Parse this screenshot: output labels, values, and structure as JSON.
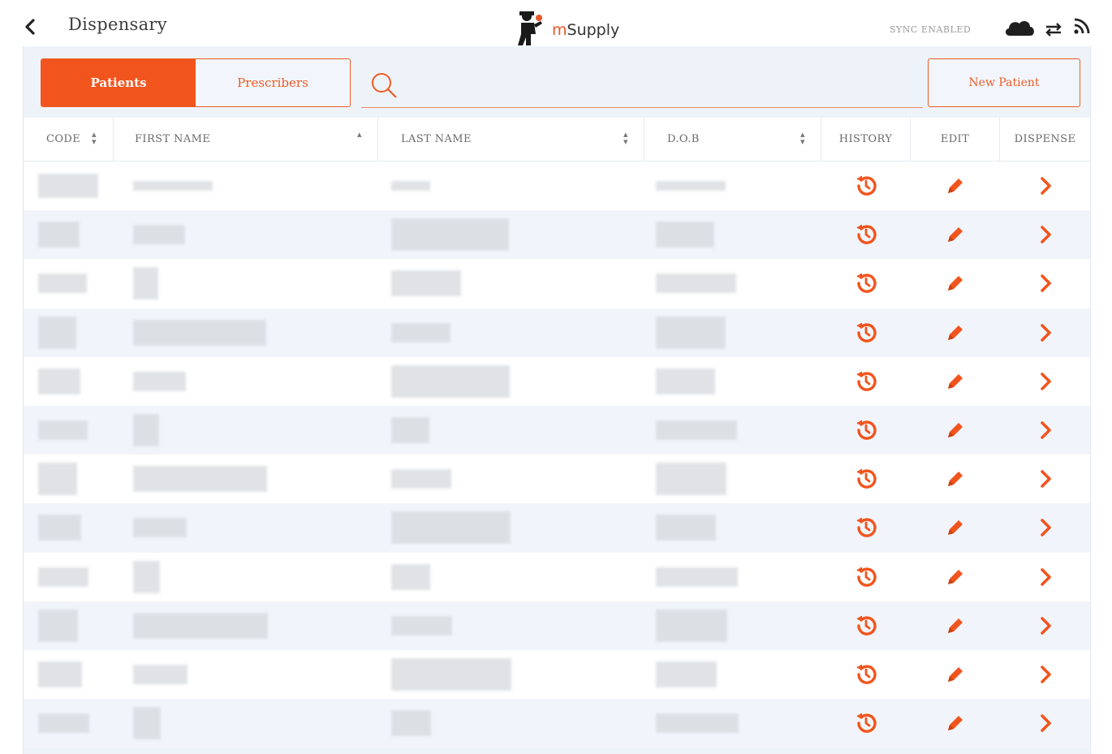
{
  "header": {
    "title": "Dispensary",
    "logo_prefix": "m",
    "logo_suffix": "Supply",
    "sync_status": "SYNC ENABLED"
  },
  "tabs": [
    {
      "label": "Patients",
      "active": true
    },
    {
      "label": "Prescribers",
      "active": false
    }
  ],
  "search": {
    "placeholder": "",
    "value": ""
  },
  "new_patient_label": "New Patient",
  "columns": {
    "code": "CODE",
    "first_name": "FIRST NAME",
    "last_name": "LAST NAME",
    "dob": "D.O.B",
    "history": "HISTORY",
    "edit": "EDIT",
    "dispense": "DISPENSE"
  },
  "rows_note_hidden": "",
  "colors": {
    "accent": "#f2541d",
    "panel_bg": "#eef3fa"
  },
  "icons": {
    "history": "history-icon",
    "edit": "pencil-icon",
    "dispense": "chevron-right-icon"
  },
  "row_count": 12
}
